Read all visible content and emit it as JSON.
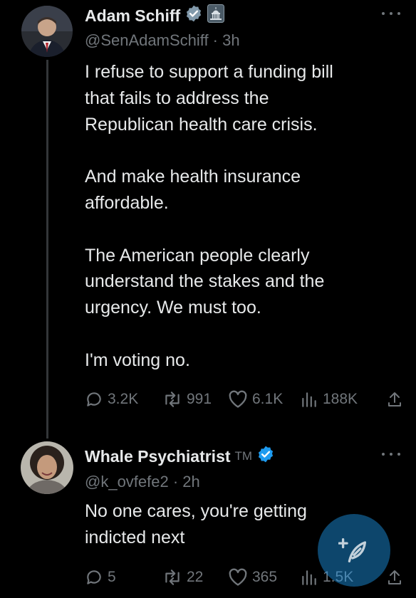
{
  "colors": {
    "background": "#000000",
    "text": "#e7e9ea",
    "secondary": "#71767b",
    "verified_blue": "#1d9bf0",
    "thread_line": "#333639"
  },
  "tweets": [
    {
      "name": "Adam Schiff",
      "badges": [
        "verified-badge-icon",
        "government-capitol-icon"
      ],
      "handle_time": "@SenAdamSchiff · 3h",
      "text": "I refuse to support a funding bill\nthat fails to address the\nRepublican health care crisis.\n\nAnd make health insurance\naffordable.\n\nThe American people clearly\nunderstand the stakes and the\nurgency. We must too.\n\nI'm voting no.",
      "replies": "3.2K",
      "reposts": "991",
      "likes": "6.1K",
      "views": "188K"
    },
    {
      "name": "Whale Psychiatrist",
      "name_suffix": "TM",
      "badges": [
        "verified-badge-icon"
      ],
      "handle_time": "@k_ovfefe2 · 2h",
      "text": "No one cares, you're getting\nindicted next",
      "replies": "5",
      "reposts": "22",
      "likes": "365",
      "views": "1.5K"
    }
  ],
  "compose_button": {
    "icon": "compose-feather-icon"
  }
}
